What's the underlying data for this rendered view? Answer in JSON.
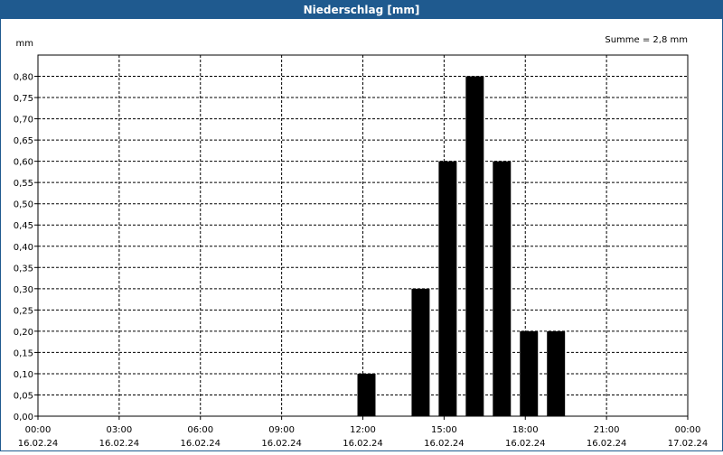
{
  "window": {
    "title": "Niederschlag [mm]"
  },
  "chart_data": {
    "type": "bar",
    "title": "Niederschlag [mm]",
    "ylabel": "mm",
    "xlabel": "",
    "annotation": "Summe = 2,8 mm",
    "ylim": [
      0,
      0.85
    ],
    "xlim_hours": [
      0,
      24
    ],
    "y_ticks": [
      "0,00",
      "0,05",
      "0,10",
      "0,15",
      "0,20",
      "0,25",
      "0,30",
      "0,35",
      "0,40",
      "0,45",
      "0,50",
      "0,55",
      "0,60",
      "0,65",
      "0,70",
      "0,75",
      "0,80"
    ],
    "x_ticks": [
      {
        "time": "00:00",
        "date": "16.02.24"
      },
      {
        "time": "03:00",
        "date": "16.02.24"
      },
      {
        "time": "06:00",
        "date": "16.02.24"
      },
      {
        "time": "09:00",
        "date": "16.02.24"
      },
      {
        "time": "12:00",
        "date": "16.02.24"
      },
      {
        "time": "15:00",
        "date": "16.02.24"
      },
      {
        "time": "18:00",
        "date": "16.02.24"
      },
      {
        "time": "21:00",
        "date": "16.02.24"
      },
      {
        "time": "00:00",
        "date": "17.02.24"
      }
    ],
    "series": [
      {
        "name": "",
        "bars": [
          {
            "hour": 12,
            "value": 0.1
          },
          {
            "hour": 14,
            "value": 0.3
          },
          {
            "hour": 15,
            "value": 0.6
          },
          {
            "hour": 16,
            "value": 0.8
          },
          {
            "hour": 17,
            "value": 0.6
          },
          {
            "hour": 18,
            "value": 0.2
          },
          {
            "hour": 19,
            "value": 0.2
          }
        ]
      }
    ],
    "grid": true,
    "bar_color": "#000000",
    "grid_color": "#000000"
  }
}
